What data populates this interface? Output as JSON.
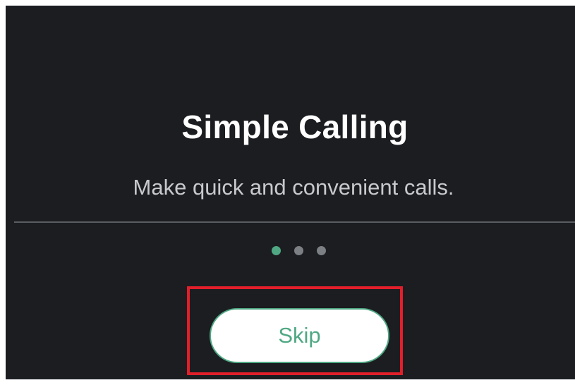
{
  "onboarding": {
    "title": "Simple Calling",
    "subtitle": "Make quick and convenient calls.",
    "page_indicator": {
      "total": 3,
      "active_index": 0
    },
    "skip_label": "Skip"
  },
  "colors": {
    "background": "#1b1d21",
    "accent": "#4fa883",
    "highlight": "#e11f2a"
  }
}
